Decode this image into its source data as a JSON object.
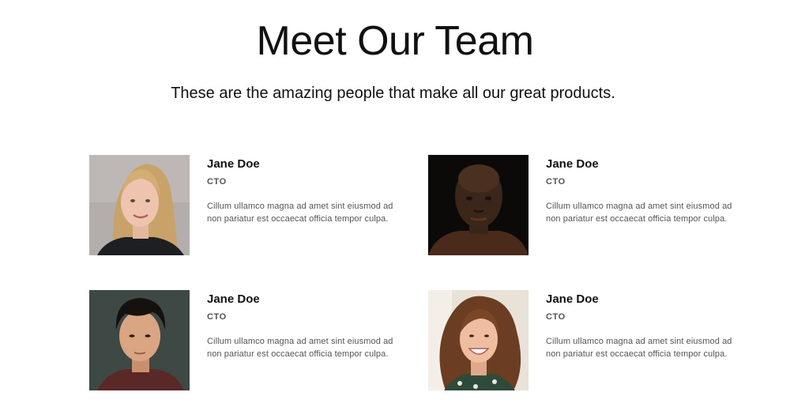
{
  "header": {
    "title": "Meet Our Team",
    "subtitle": "These are the amazing people that make all our great products."
  },
  "team": [
    {
      "name": "Jane Doe",
      "role": "CTO",
      "bio": "Cillum ullamco magna ad amet sint eiusmod ad non pariatur est occaecat officia tempor culpa.",
      "photo_icon": "woman-portrait-blonde"
    },
    {
      "name": "Jane Doe",
      "role": "CTO",
      "bio": "Cillum ullamco magna ad amet sint eiusmod ad non pariatur est occaecat officia tempor culpa.",
      "photo_icon": "man-portrait-dark"
    },
    {
      "name": "Jane Doe",
      "role": "CTO",
      "bio": "Cillum ullamco magna ad amet sint eiusmod ad non pariatur est occaecat officia tempor culpa.",
      "photo_icon": "man-portrait-young"
    },
    {
      "name": "Jane Doe",
      "role": "CTO",
      "bio": "Cillum ullamco magna ad amet sint eiusmod ad non pariatur est occaecat officia tempor culpa.",
      "photo_icon": "woman-portrait-curly"
    }
  ]
}
